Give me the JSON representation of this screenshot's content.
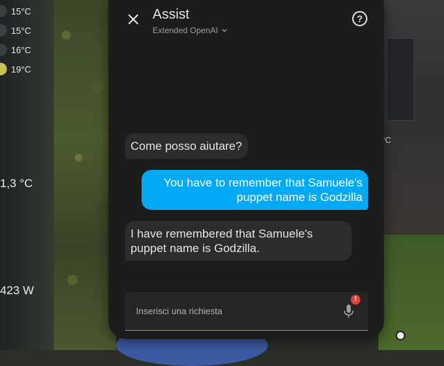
{
  "background": {
    "sensors": [
      {
        "label": "15°C",
        "color": "#3a3f44"
      },
      {
        "label": "15°C",
        "color": "#3a3f44"
      },
      {
        "label": "16°C",
        "color": "#3a3f44"
      },
      {
        "label": "19°C",
        "color": "#c8c25a"
      }
    ],
    "temp_value": "1,3 °C",
    "power_value": "423 W",
    "edge_label": "°C"
  },
  "dialog": {
    "title": "Assist",
    "subtitle": "Extended OpenAI",
    "close_icon": "close-icon",
    "help_icon": "help-circle-icon",
    "help_glyph": "?"
  },
  "messages": [
    {
      "from": "assistant",
      "text": "Come posso aiutare?"
    },
    {
      "from": "user",
      "text": "You have to remember that Samuele's puppet name is Godzilla"
    },
    {
      "from": "assistant",
      "text": "I have remembered that Samuele's puppet name is Godzilla."
    }
  ],
  "input": {
    "placeholder": "Inserisci una richiesta",
    "value": "",
    "mic_icon": "microphone-icon",
    "badge": "!"
  },
  "colors": {
    "user_bubble": "#03a9f4",
    "assistant_bubble": "#2c2c2c",
    "dialog_bg": "#1c1c1c",
    "badge": "#db4437"
  }
}
